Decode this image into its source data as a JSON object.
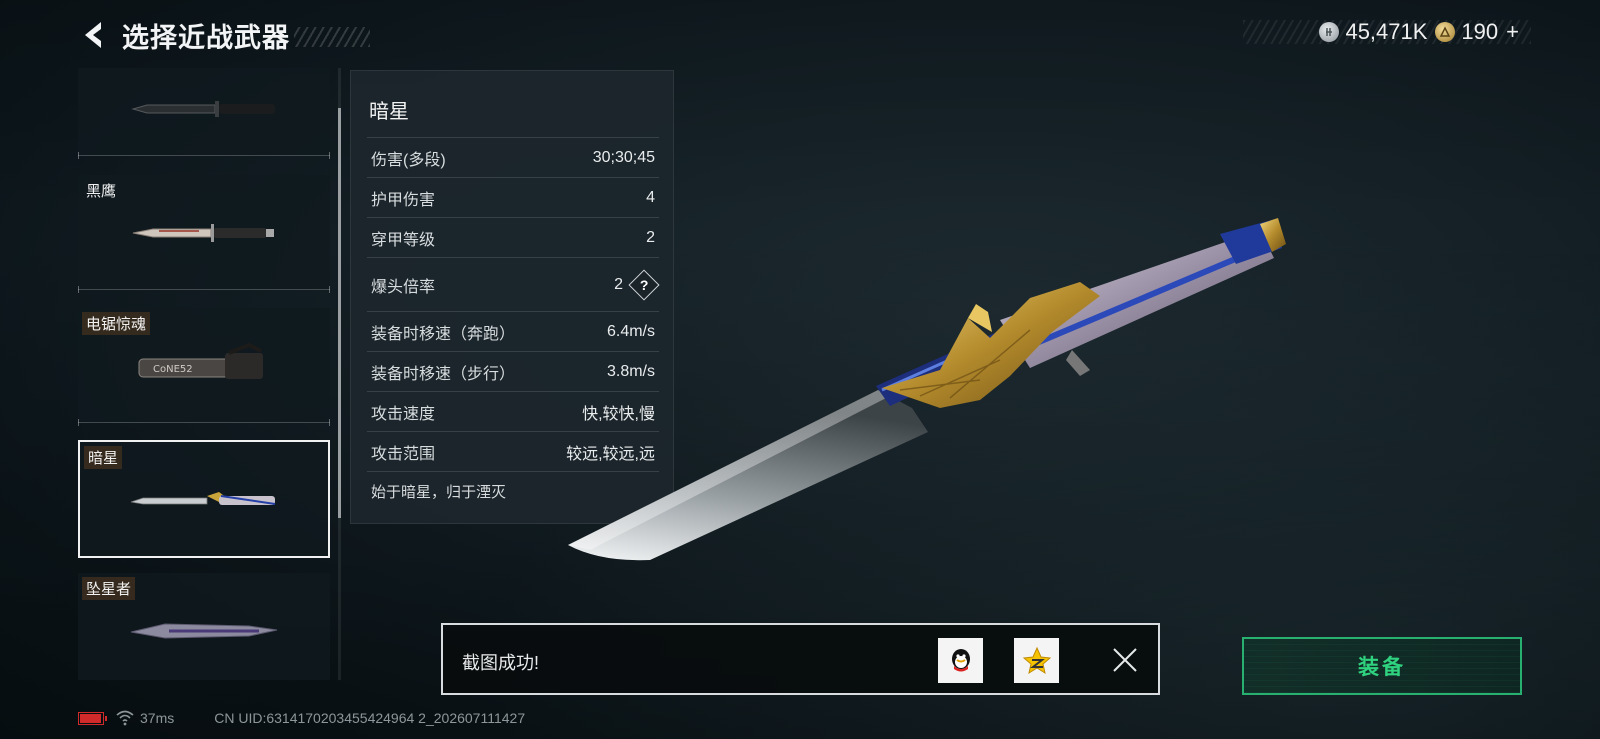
{
  "header": {
    "title": "选择近战武器",
    "back_icon": "back-arrow-icon"
  },
  "currency": [
    {
      "icon": "silver-coin-icon",
      "value": "45,471K"
    },
    {
      "icon": "gold-coin-icon",
      "value": "190"
    }
  ],
  "weapon_list": {
    "items": [
      {
        "name": ""
      },
      {
        "name": "黑鹰"
      },
      {
        "name": "电锯惊魂"
      },
      {
        "name": "暗星",
        "selected": true
      },
      {
        "name": "坠星者"
      }
    ],
    "scroll_fraction": 0.2
  },
  "stats": {
    "title": "暗星",
    "rows": [
      {
        "label": "伤害(多段)",
        "value": "30;30;45"
      },
      {
        "label": "护甲伤害",
        "value": "4"
      },
      {
        "label": "穿甲等级",
        "value": "2"
      },
      {
        "label": "爆头倍率",
        "value": "2",
        "help": "?"
      },
      {
        "label": "装备时移速（奔跑）",
        "value": "6.4m/s"
      },
      {
        "label": "装备时移速（步行）",
        "value": "3.8m/s"
      },
      {
        "label": "攻击速度",
        "value": "快,较快,慢"
      },
      {
        "label": "攻击范围",
        "value": "较远,较远,远"
      }
    ],
    "description": "始于暗星，归于湮灭"
  },
  "toast": {
    "message": "截图成功!",
    "share_icons": [
      "qq-icon",
      "qzone-star-icon"
    ],
    "close_icon": "close-icon"
  },
  "equip_button": {
    "label": "装备"
  },
  "status_bar": {
    "battery_level": 0.95,
    "battery_color": "#d02a2a",
    "ping": "37ms",
    "uid": "CN UID:6314170203455424964 2_202607111427"
  },
  "colors": {
    "accent_green": "#2fd27f",
    "selected_border": "#f1f1f1"
  }
}
